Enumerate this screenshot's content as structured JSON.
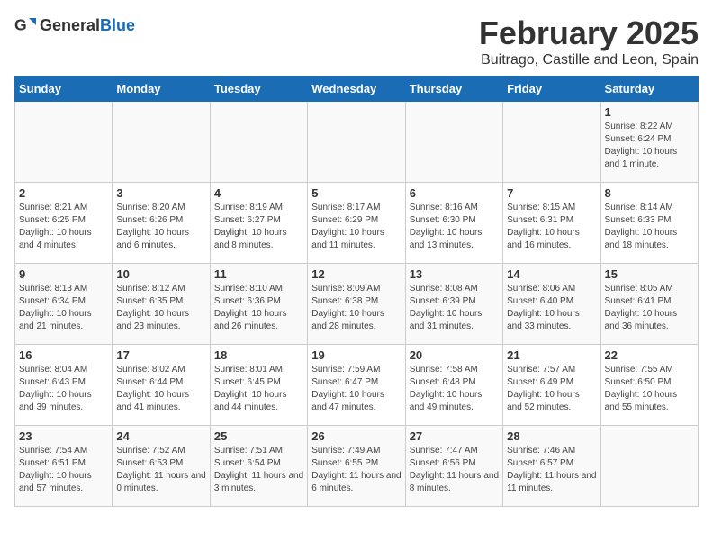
{
  "header": {
    "logo_general": "General",
    "logo_blue": "Blue",
    "title": "February 2025",
    "subtitle": "Buitrago, Castille and Leon, Spain"
  },
  "weekdays": [
    "Sunday",
    "Monday",
    "Tuesday",
    "Wednesday",
    "Thursday",
    "Friday",
    "Saturday"
  ],
  "weeks": [
    [
      {
        "day": "",
        "info": ""
      },
      {
        "day": "",
        "info": ""
      },
      {
        "day": "",
        "info": ""
      },
      {
        "day": "",
        "info": ""
      },
      {
        "day": "",
        "info": ""
      },
      {
        "day": "",
        "info": ""
      },
      {
        "day": "1",
        "info": "Sunrise: 8:22 AM\nSunset: 6:24 PM\nDaylight: 10 hours and 1 minute."
      }
    ],
    [
      {
        "day": "2",
        "info": "Sunrise: 8:21 AM\nSunset: 6:25 PM\nDaylight: 10 hours and 4 minutes."
      },
      {
        "day": "3",
        "info": "Sunrise: 8:20 AM\nSunset: 6:26 PM\nDaylight: 10 hours and 6 minutes."
      },
      {
        "day": "4",
        "info": "Sunrise: 8:19 AM\nSunset: 6:27 PM\nDaylight: 10 hours and 8 minutes."
      },
      {
        "day": "5",
        "info": "Sunrise: 8:17 AM\nSunset: 6:29 PM\nDaylight: 10 hours and 11 minutes."
      },
      {
        "day": "6",
        "info": "Sunrise: 8:16 AM\nSunset: 6:30 PM\nDaylight: 10 hours and 13 minutes."
      },
      {
        "day": "7",
        "info": "Sunrise: 8:15 AM\nSunset: 6:31 PM\nDaylight: 10 hours and 16 minutes."
      },
      {
        "day": "8",
        "info": "Sunrise: 8:14 AM\nSunset: 6:33 PM\nDaylight: 10 hours and 18 minutes."
      }
    ],
    [
      {
        "day": "9",
        "info": "Sunrise: 8:13 AM\nSunset: 6:34 PM\nDaylight: 10 hours and 21 minutes."
      },
      {
        "day": "10",
        "info": "Sunrise: 8:12 AM\nSunset: 6:35 PM\nDaylight: 10 hours and 23 minutes."
      },
      {
        "day": "11",
        "info": "Sunrise: 8:10 AM\nSunset: 6:36 PM\nDaylight: 10 hours and 26 minutes."
      },
      {
        "day": "12",
        "info": "Sunrise: 8:09 AM\nSunset: 6:38 PM\nDaylight: 10 hours and 28 minutes."
      },
      {
        "day": "13",
        "info": "Sunrise: 8:08 AM\nSunset: 6:39 PM\nDaylight: 10 hours and 31 minutes."
      },
      {
        "day": "14",
        "info": "Sunrise: 8:06 AM\nSunset: 6:40 PM\nDaylight: 10 hours and 33 minutes."
      },
      {
        "day": "15",
        "info": "Sunrise: 8:05 AM\nSunset: 6:41 PM\nDaylight: 10 hours and 36 minutes."
      }
    ],
    [
      {
        "day": "16",
        "info": "Sunrise: 8:04 AM\nSunset: 6:43 PM\nDaylight: 10 hours and 39 minutes."
      },
      {
        "day": "17",
        "info": "Sunrise: 8:02 AM\nSunset: 6:44 PM\nDaylight: 10 hours and 41 minutes."
      },
      {
        "day": "18",
        "info": "Sunrise: 8:01 AM\nSunset: 6:45 PM\nDaylight: 10 hours and 44 minutes."
      },
      {
        "day": "19",
        "info": "Sunrise: 7:59 AM\nSunset: 6:47 PM\nDaylight: 10 hours and 47 minutes."
      },
      {
        "day": "20",
        "info": "Sunrise: 7:58 AM\nSunset: 6:48 PM\nDaylight: 10 hours and 49 minutes."
      },
      {
        "day": "21",
        "info": "Sunrise: 7:57 AM\nSunset: 6:49 PM\nDaylight: 10 hours and 52 minutes."
      },
      {
        "day": "22",
        "info": "Sunrise: 7:55 AM\nSunset: 6:50 PM\nDaylight: 10 hours and 55 minutes."
      }
    ],
    [
      {
        "day": "23",
        "info": "Sunrise: 7:54 AM\nSunset: 6:51 PM\nDaylight: 10 hours and 57 minutes."
      },
      {
        "day": "24",
        "info": "Sunrise: 7:52 AM\nSunset: 6:53 PM\nDaylight: 11 hours and 0 minutes."
      },
      {
        "day": "25",
        "info": "Sunrise: 7:51 AM\nSunset: 6:54 PM\nDaylight: 11 hours and 3 minutes."
      },
      {
        "day": "26",
        "info": "Sunrise: 7:49 AM\nSunset: 6:55 PM\nDaylight: 11 hours and 6 minutes."
      },
      {
        "day": "27",
        "info": "Sunrise: 7:47 AM\nSunset: 6:56 PM\nDaylight: 11 hours and 8 minutes."
      },
      {
        "day": "28",
        "info": "Sunrise: 7:46 AM\nSunset: 6:57 PM\nDaylight: 11 hours and 11 minutes."
      },
      {
        "day": "",
        "info": ""
      }
    ]
  ]
}
